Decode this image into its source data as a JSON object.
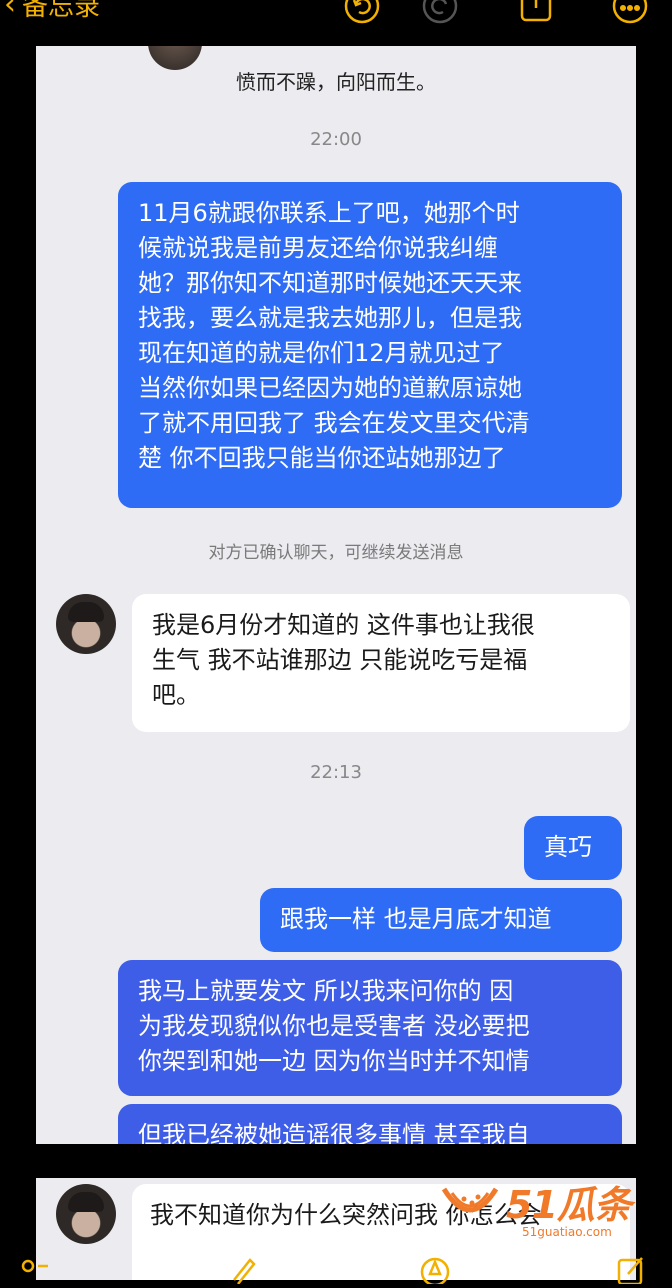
{
  "app": {
    "back_label": "备忘录"
  },
  "chat1": {
    "motto": "愤而不躁，向阳而生。",
    "time1": "22:00",
    "msg1_lines": [
      "11月6就跟你联系上了吧，她那个时",
      "候就说我是前男友还给你说我纠缠",
      "她？那你知不知道那时候她还天天来",
      "找我，要么就是我去她那儿，但是我",
      "现在知道的就是你们12月就见过了",
      "当然你如果已经因为她的道歉原谅她",
      "了就不用回我了 我会在发文里交代清",
      "楚 你不回我只能当你还站她那边了"
    ],
    "system_notice": "对方已确认聊天，可继续发送消息",
    "reply_lines": [
      "我是6月份才知道的 这件事也让我很",
      "生气 我不站谁那边 只能说吃亏是福",
      "吧。"
    ],
    "time2": "22:13",
    "msg2": "真巧",
    "msg3": "跟我一样 也是月底才知道",
    "msg4_lines": [
      "我马上就要发文 所以我来问你的 因",
      "为我发现貌似你也是受害者 没必要把",
      "你架到和她一边 因为你当时并不知情"
    ],
    "msg5_partial": "但我已经被她造谣很多事情 甚至我自"
  },
  "chat2": {
    "reply_partial": "我不知道你为什么突然问我 你怎么会"
  },
  "watermark": {
    "brand": "51瓜条",
    "url": "51guatiao.com"
  },
  "colors": {
    "accent": "#f2b100",
    "my_bubble": "#2f6cf6",
    "their_bubble": "#ffffff",
    "chat_bg": "#ebebf0"
  }
}
